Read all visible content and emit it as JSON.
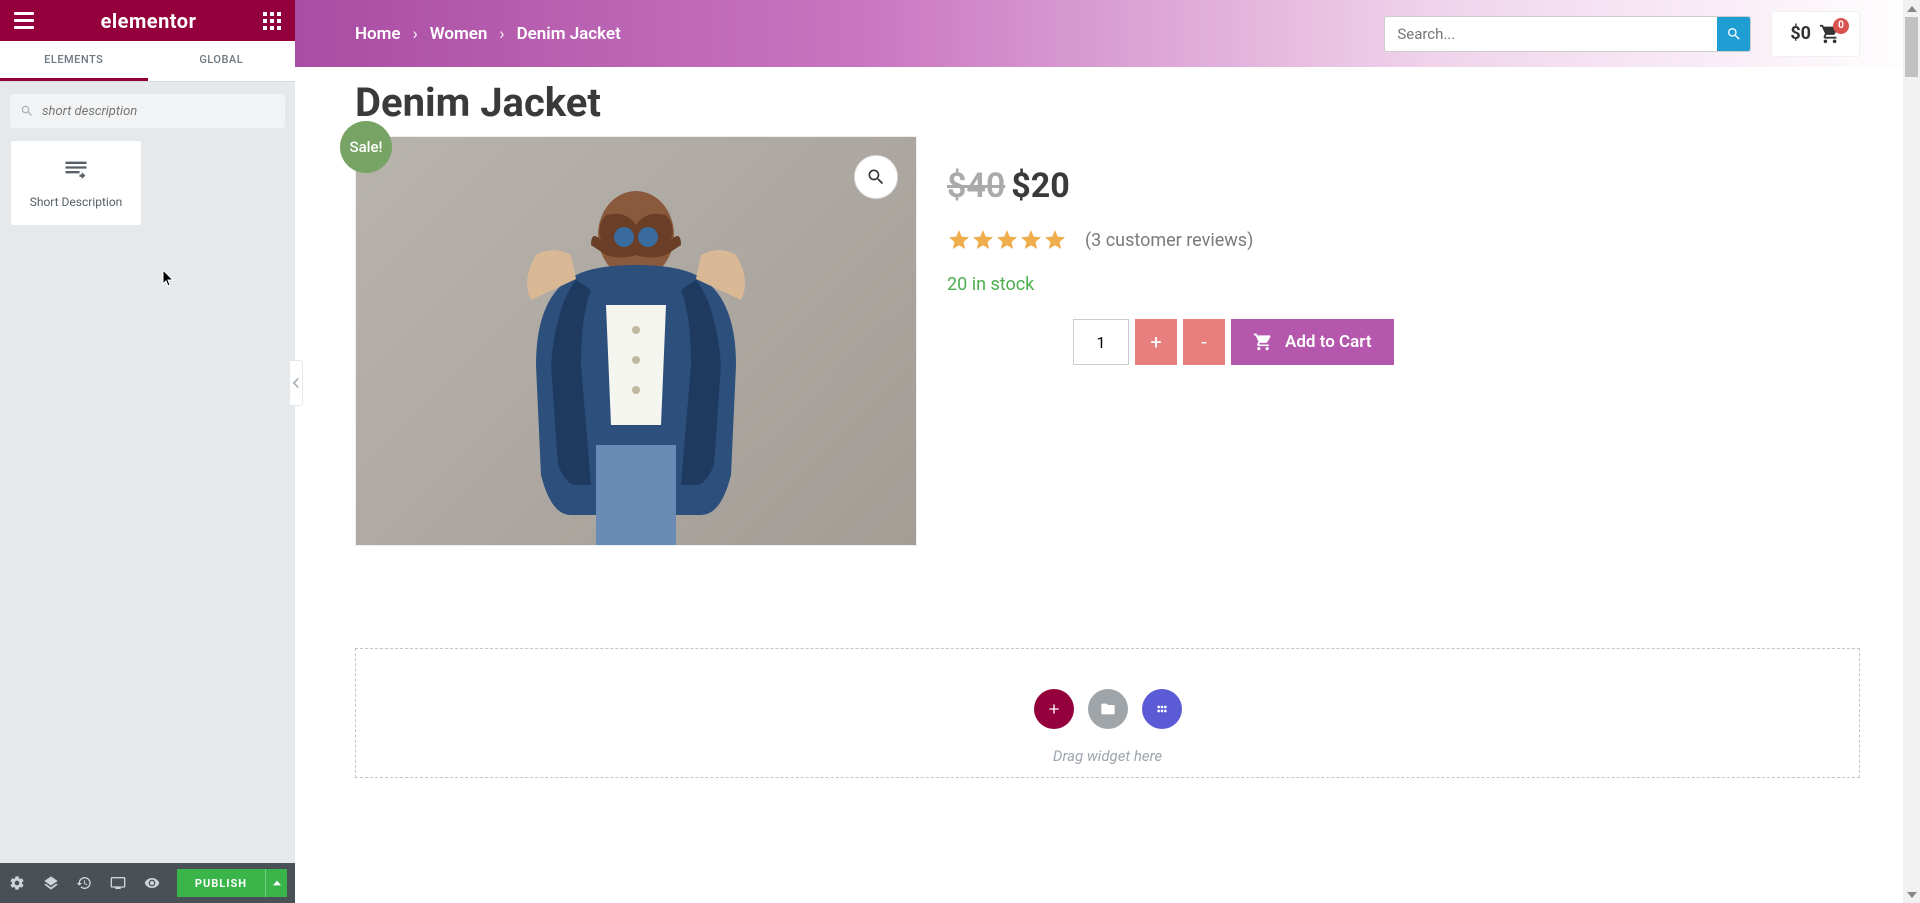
{
  "panel": {
    "logo": "elementor",
    "tabs": {
      "elements": "ELEMENTS",
      "global": "GLOBAL"
    },
    "search_placeholder": "short description",
    "widget": {
      "label": "Short Description"
    },
    "footer": {
      "publish": "PUBLISH"
    }
  },
  "topbar": {
    "breadcrumb": [
      "Home",
      "Women",
      "Denim Jacket"
    ],
    "search_placeholder": "Search...",
    "cart_amount": "$0",
    "cart_count": "0"
  },
  "product": {
    "title": "Denim Jacket",
    "sale_badge": "Sale!",
    "price_old": "$40",
    "price_new": "$20",
    "reviews": "(3 customer reviews)",
    "stock": "20 in stock",
    "qty": "1",
    "inc": "+",
    "dec": "-",
    "add": "Add to Cart"
  },
  "drop": {
    "text": "Drag widget here"
  }
}
